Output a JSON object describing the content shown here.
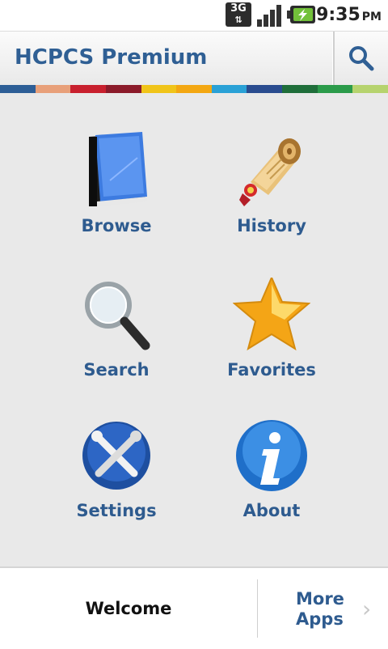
{
  "status_bar": {
    "network": "3G",
    "time": "9:35",
    "ampm": "PM"
  },
  "header": {
    "title": "HCPCS Premium",
    "search_icon": "search-icon"
  },
  "color_strip": [
    "#2d5e96",
    "#e8a07a",
    "#c8202e",
    "#8b1b2a",
    "#f0c419",
    "#f3a712",
    "#2aa1d6",
    "#2a4c8f",
    "#1f6e3a",
    "#2b9b4a",
    "#b6d36e"
  ],
  "menu": {
    "items": [
      {
        "label": "Browse",
        "icon": "book-icon"
      },
      {
        "label": "History",
        "icon": "scroll-icon"
      },
      {
        "label": "Search",
        "icon": "magnifier-icon"
      },
      {
        "label": "Favorites",
        "icon": "star-icon"
      },
      {
        "label": "Settings",
        "icon": "tools-icon"
      },
      {
        "label": "About",
        "icon": "info-icon"
      }
    ]
  },
  "footer": {
    "welcome": "Welcome",
    "more_apps_line1": "More",
    "more_apps_line2": "Apps",
    "chevron": "›"
  }
}
